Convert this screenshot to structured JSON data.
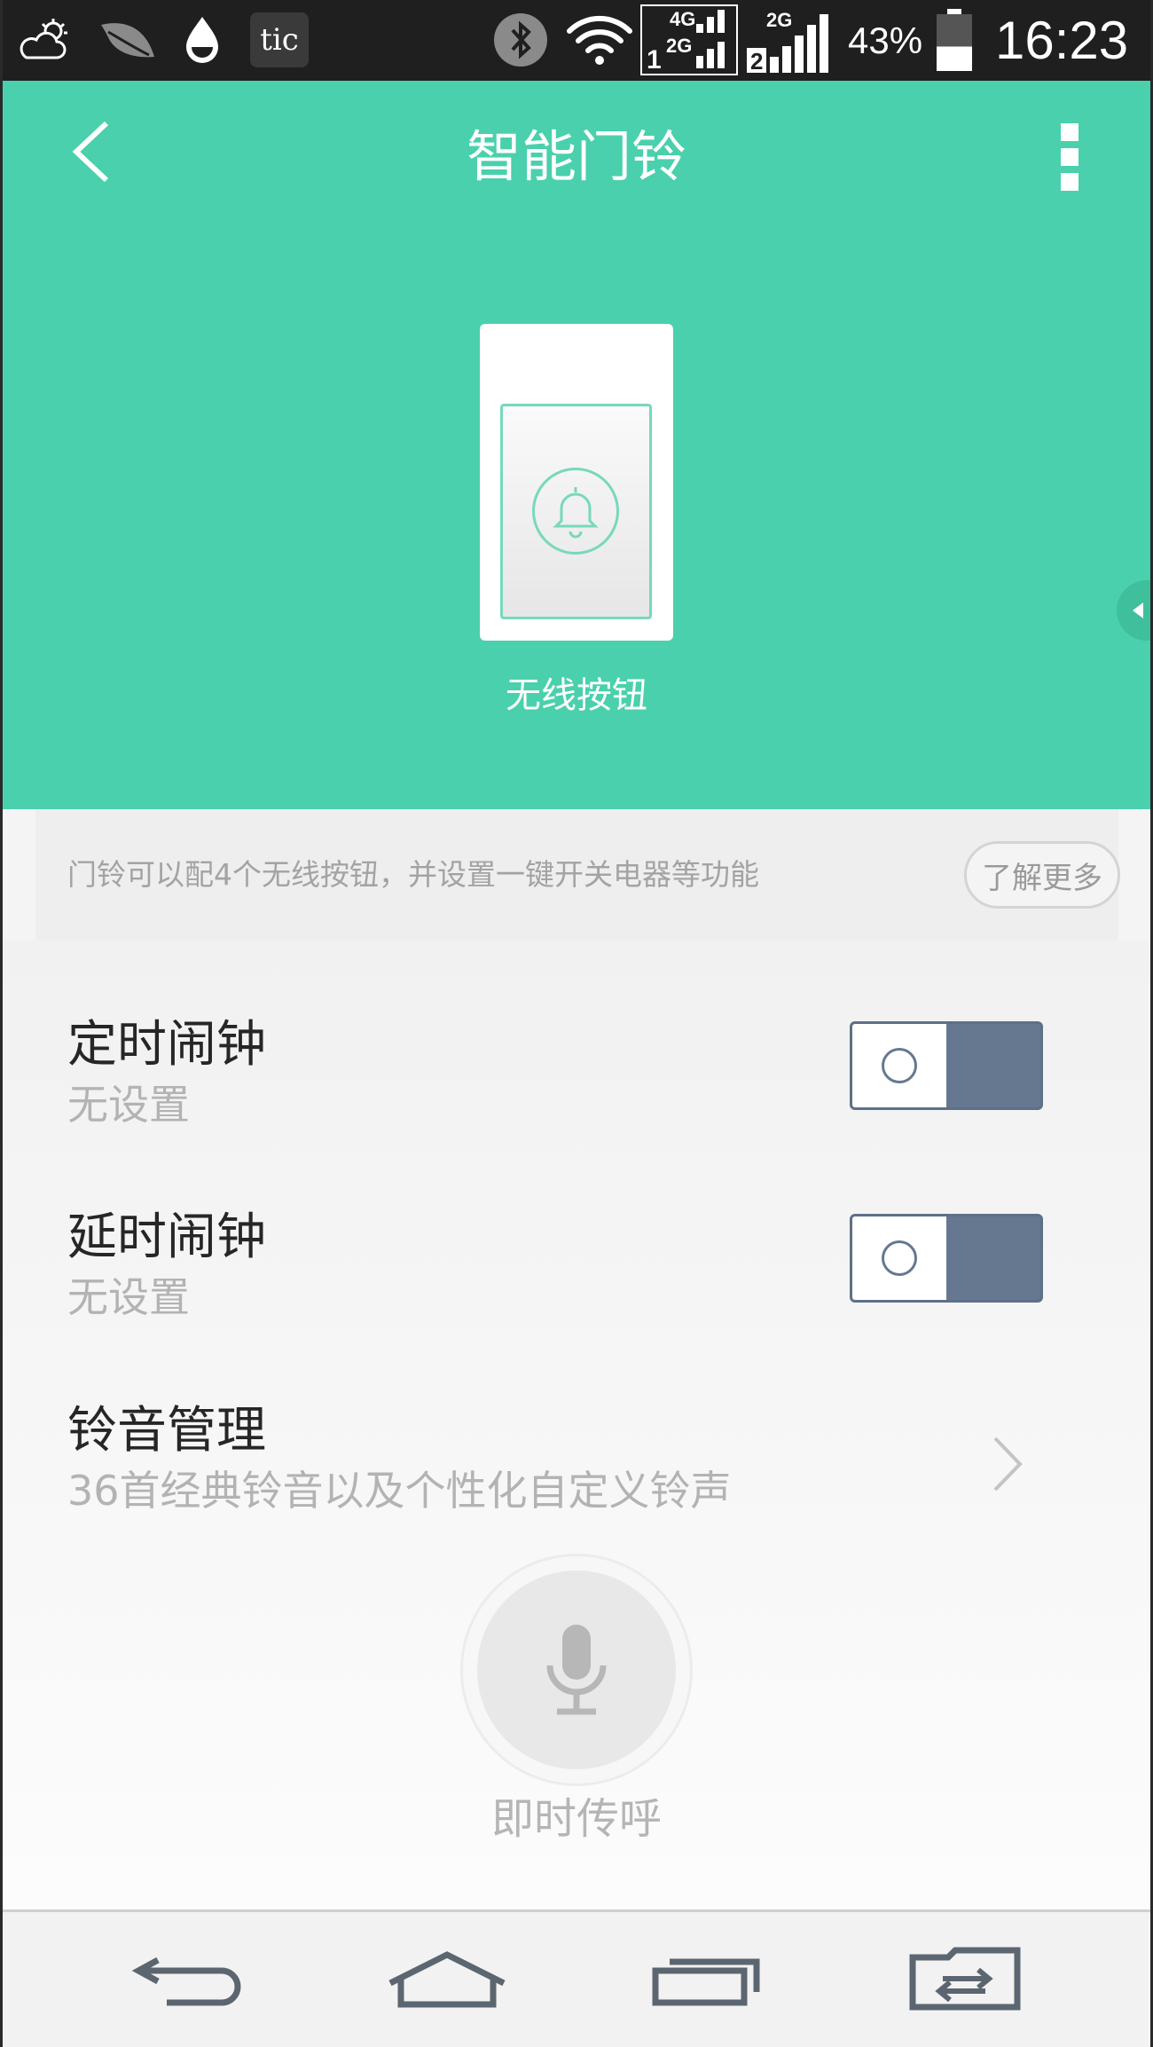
{
  "status_bar": {
    "icons": [
      "weather-cloud-icon",
      "leaf-icon",
      "water-drop-icon",
      "tic-app-icon",
      "bluetooth-icon",
      "wifi-icon",
      "sim1-signal-icon",
      "sim2-signal-icon",
      "battery-icon"
    ],
    "tic_label": "tic",
    "sim1_top_label": "4G",
    "sim1_mid_label": "2G",
    "sim1_num": "1",
    "sim2_top_label": "2G",
    "sim2_num": "2",
    "battery_percent": "43%",
    "battery_level": 0.43,
    "time": "16:23"
  },
  "header": {
    "title": "智能门铃",
    "device_label": "无线按钮",
    "bg_color": "#4ad0ac"
  },
  "info_banner": {
    "text": "门铃可以配4个无线按钮，并设置一键开关电器等功能",
    "more_button": "了解更多"
  },
  "settings": {
    "timer_alarm": {
      "title": "定时闹钟",
      "subtitle": "无设置",
      "enabled": false
    },
    "delay_alarm": {
      "title": "延时闹钟",
      "subtitle": "无设置",
      "enabled": false
    },
    "ringtone": {
      "title": "铃音管理",
      "subtitle": "36首经典铃音以及个性化自定义铃声"
    }
  },
  "intercom": {
    "label": "即时传呼"
  },
  "nav_bar": {
    "icons": [
      "back-icon",
      "home-icon",
      "recents-icon",
      "dual-window-icon"
    ]
  }
}
